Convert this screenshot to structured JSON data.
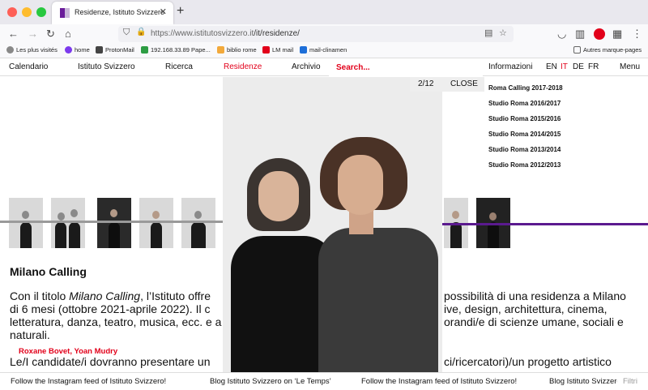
{
  "browser": {
    "tab_title": "Residenze, Istituto Svizzero",
    "tab_close": "✕",
    "new_tab": "+",
    "url_host": "https://www.istitutosvizzero.it",
    "url_path": "/it/residenze/",
    "icons": {
      "back": "←",
      "forward": "→",
      "reload": "↻",
      "home": "⌂",
      "shield": "⛉",
      "lock": "🔒",
      "reader": "▤",
      "star": "☆",
      "pocket": "◡",
      "sidebar": "▥",
      "grid": "▦",
      "more": "⋮"
    }
  },
  "bookmarks": [
    {
      "label": "Les plus visités",
      "icon": "gear-icon",
      "color": "#666666"
    },
    {
      "label": "home",
      "icon": "person-icon",
      "color": "#7c3aed"
    },
    {
      "label": "ProtonMail",
      "icon": "proton-icon",
      "color": "#444444"
    },
    {
      "label": "192.168.33.89 Pape...",
      "icon": "paper-icon",
      "color": "#2e9d44"
    },
    {
      "label": "biblio rome",
      "icon": "book-icon",
      "color": "#f2a93b"
    },
    {
      "label": "LM mail",
      "icon": "mail-icon",
      "color": "#e2001a"
    },
    {
      "label": "mail-clinamen",
      "icon": "zimbra-icon",
      "color": "#1e6fd9"
    },
    {
      "label": "Autres marque-pages",
      "icon": "folder-icon",
      "color": "#666666"
    }
  ],
  "site_nav": {
    "items": [
      "Calendario",
      "Istituto Svizzero",
      "Ricerca",
      "Residenze",
      "Archivio"
    ],
    "active": "Residenze",
    "search_placeholder": "Search...",
    "informazioni": "Informazioni",
    "languages": [
      "EN",
      "IT",
      "DE",
      "FR"
    ],
    "active_language": "IT",
    "menu": "Menu"
  },
  "side_list": [
    "Roma Calling 2017-2018",
    "Studio Roma 2016/2017",
    "Studio Roma 2015/2016",
    "Studio Roma 2014/2015",
    "Studio Roma 2013/2014",
    "Studio Roma 2012/2013"
  ],
  "content": {
    "section_title": "Milano Calling",
    "para_1a": "Con il titolo ",
    "para_1_em": "Milano Calling",
    "para_1b": ", l’Istituto offre",
    "para_1c": "possibilità di una residenza a Milano",
    "para_2a": "di 6 mesi (ottobre 2021-aprile 2022). Il c",
    "para_2b": "ive, design, architettura, cinema,",
    "para_3a": "letteratura, danza, teatro, musica, ecc. e a",
    "para_3b": "orandi/e di scienze umane, sociali e",
    "para_4": "naturali.",
    "para_5a": "Le/I candidate/i dovranno presentare un",
    "para_5b": "ci/ricercatori)/un progetto artistico"
  },
  "lightbox": {
    "counter": "2/12",
    "close": "CLOSE",
    "caption": "Roxane Bovet, Yoan Mudry"
  },
  "ticker": {
    "items": [
      "Follow the Instagram feed of Istituto Svizzero!",
      "Blog Istituto Svizzero on ‘Le Temps’",
      "Follow the Instagram feed of Istituto Svizzero!",
      "Blog Istituto Svizzero on ‘Le Temps’"
    ],
    "filter_label": "Filtri"
  },
  "colors": {
    "accent_red": "#e2001a",
    "line_gray": "#9a9a9a",
    "line_purple": "#5b1a8f"
  }
}
